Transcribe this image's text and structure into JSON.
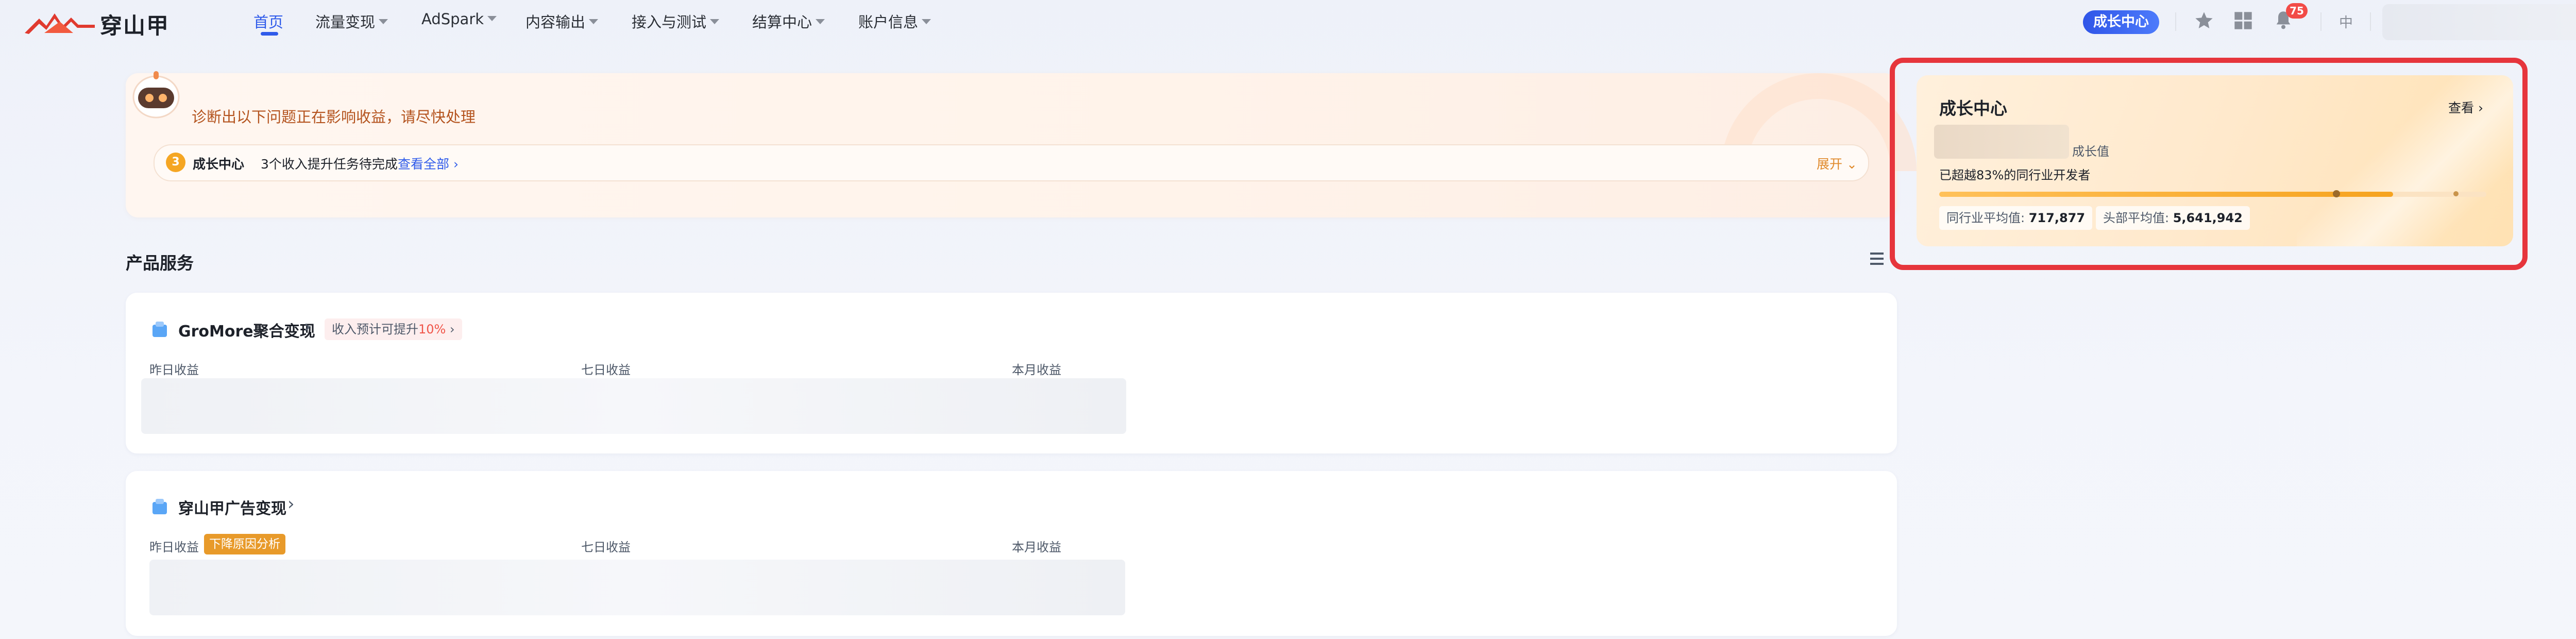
{
  "brand": {
    "name": "穿山甲",
    "logo_icon": "pangolin-logo-icon"
  },
  "nav": {
    "items": [
      {
        "label": "首页",
        "active": true,
        "has_dropdown": false
      },
      {
        "label": "流量变现",
        "has_dropdown": true
      },
      {
        "label": "AdSpark",
        "has_dropdown": true
      },
      {
        "label": "内容输出",
        "has_dropdown": true
      },
      {
        "label": "接入与测试",
        "has_dropdown": true
      },
      {
        "label": "结算中心",
        "has_dropdown": true
      },
      {
        "label": "账户信息",
        "has_dropdown": true
      }
    ],
    "growth_center_button": "成长中心",
    "notification_count": "75",
    "language": "中",
    "icons": [
      "star-icon",
      "apps-grid-icon",
      "bell-icon"
    ]
  },
  "alert": {
    "title": "诊断出以下问题正在影响收益，请尽快处理",
    "row": {
      "badge": "3",
      "label": "成长中心",
      "text": "3个收入提升任务待完成",
      "link": "查看全部",
      "expand": "展开"
    }
  },
  "products": {
    "section_title": "产品服务",
    "cards": [
      {
        "title": "GroMore聚合变现",
        "tag_prefix": "收入预计可提升",
        "tag_highlight": "10%",
        "metrics": [
          "昨日收益",
          "七日收益",
          "本月收益"
        ]
      },
      {
        "title": "穿山甲广告变现",
        "decline_tag": "下降原因分析",
        "metrics": [
          "昨日收益",
          "七日收益",
          "本月收益"
        ]
      }
    ]
  },
  "growth": {
    "title": "成长中心",
    "view": "查看",
    "value_label": "成长值",
    "exceed_text": "已超越83%的同行业开发者",
    "progress": 0.83,
    "industry_avg_label": "同行业平均值:",
    "industry_avg_value": "717,877",
    "top_avg_label": "头部平均值:",
    "top_avg_value": "5,641,942",
    "colors": {
      "accent": "#f6a31f",
      "highlight_border": "#e6353c"
    }
  }
}
